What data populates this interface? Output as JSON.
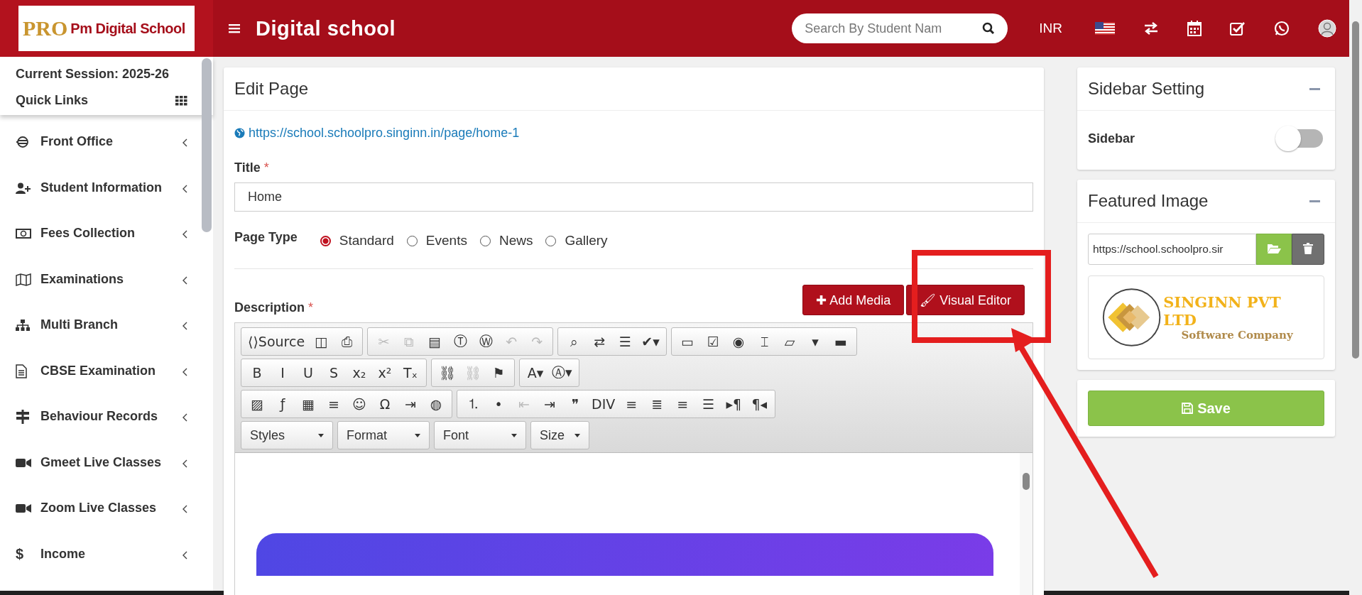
{
  "header": {
    "logo_badge": "PRO",
    "logo_text": "Pm Digital School",
    "title": "Digital school",
    "search": {
      "placeholder": "Search By Student Nam"
    },
    "currency": "INR"
  },
  "sidebar": {
    "session": "Current Session: 2025-26",
    "quick_links": "Quick Links",
    "items": [
      {
        "label": "Front Office"
      },
      {
        "label": "Student Information"
      },
      {
        "label": "Fees Collection"
      },
      {
        "label": "Examinations"
      },
      {
        "label": "Multi Branch"
      },
      {
        "label": "CBSE Examination"
      },
      {
        "label": "Behaviour Records"
      },
      {
        "label": "Gmeet Live Classes"
      },
      {
        "label": "Zoom Live Classes"
      },
      {
        "label": "Income",
        "glyph": "$"
      }
    ]
  },
  "edit_page": {
    "title": "Edit Page",
    "url": "https://school.schoolpro.singinn.in/page/home-1",
    "title_label": "Title",
    "required_mark": "*",
    "title_value": "Home",
    "page_type_label": "Page Type",
    "page_types": [
      {
        "label": "Standard",
        "selected": true
      },
      {
        "label": "Events",
        "selected": false
      },
      {
        "label": "News",
        "selected": false
      },
      {
        "label": "Gallery",
        "selected": false
      }
    ],
    "description_label": "Description",
    "buttons": [
      {
        "label": "Add Media",
        "glyph": "✚"
      },
      {
        "label": "Visual Editor",
        "glyph": "🖌"
      }
    ],
    "toolbar": [
      [
        [
          {
            "label": "Source",
            "glyph": "⟨⟩",
            "disabled": false
          },
          {
            "glyph": "◫",
            "disabled": false
          },
          {
            "glyph": "⎙",
            "disabled": false
          }
        ],
        [
          {
            "glyph": "✂",
            "disabled": true
          },
          {
            "glyph": "⧉",
            "disabled": true
          },
          {
            "glyph": "▤",
            "disabled": false
          },
          {
            "glyph": "Ⓣ",
            "disabled": false
          },
          {
            "glyph": "Ⓦ",
            "disabled": false
          },
          {
            "glyph": "↶",
            "disabled": true
          },
          {
            "glyph": "↷",
            "disabled": true
          }
        ],
        [
          {
            "glyph": "⌕",
            "disabled": false
          },
          {
            "glyph": "⇄",
            "disabled": false
          },
          {
            "glyph": "☰",
            "disabled": false
          },
          {
            "glyph": "✔▾",
            "disabled": false
          }
        ],
        [
          {
            "glyph": "▭",
            "disabled": false
          },
          {
            "glyph": "☑",
            "disabled": false
          },
          {
            "glyph": "◉",
            "disabled": false
          },
          {
            "glyph": "⌶",
            "disabled": false
          },
          {
            "glyph": "▱",
            "disabled": false
          },
          {
            "glyph": "▾",
            "disabled": false
          },
          {
            "glyph": "▬",
            "disabled": false
          }
        ]
      ],
      [
        [
          {
            "glyph": "B",
            "disabled": false
          },
          {
            "glyph": "I",
            "disabled": false
          },
          {
            "glyph": "U",
            "disabled": false
          },
          {
            "glyph": "S",
            "disabled": false
          },
          {
            "glyph": "x₂",
            "disabled": false
          },
          {
            "glyph": "x²",
            "disabled": false
          },
          {
            "glyph": "Tₓ",
            "disabled": false
          }
        ],
        [
          {
            "glyph": "⛓",
            "disabled": false
          },
          {
            "glyph": "⛓",
            "disabled": true
          },
          {
            "glyph": "⚑",
            "disabled": false
          }
        ],
        [
          {
            "glyph": "A▾",
            "disabled": false
          },
          {
            "glyph": "Ⓐ▾",
            "disabled": false
          }
        ]
      ],
      [
        [
          {
            "glyph": "▨",
            "disabled": false
          },
          {
            "glyph": "ƒ",
            "disabled": false
          },
          {
            "glyph": "▦",
            "disabled": false
          },
          {
            "glyph": "≡",
            "disabled": false
          },
          {
            "glyph": "☺",
            "disabled": false
          },
          {
            "glyph": "Ω",
            "disabled": false
          },
          {
            "glyph": "⇥",
            "disabled": false
          },
          {
            "glyph": "◍",
            "disabled": false
          }
        ],
        [
          {
            "glyph": "⒈",
            "disabled": false
          },
          {
            "glyph": "•",
            "disabled": false
          },
          {
            "glyph": "⇤",
            "disabled": true
          },
          {
            "glyph": "⇥",
            "disabled": false
          },
          {
            "glyph": "❞",
            "disabled": false
          },
          {
            "glyph": "DIV",
            "disabled": false
          },
          {
            "glyph": "≡",
            "disabled": false
          },
          {
            "glyph": "≣",
            "disabled": false
          },
          {
            "glyph": "≡",
            "disabled": false
          },
          {
            "glyph": "☰",
            "disabled": false
          },
          {
            "glyph": "▸¶",
            "disabled": false
          },
          {
            "glyph": "¶◂",
            "disabled": false
          }
        ]
      ]
    ],
    "dropdowns": [
      "Styles",
      "Format",
      "Font",
      "Size"
    ]
  },
  "sidebar_setting": {
    "title": "Sidebar Setting",
    "label": "Sidebar",
    "on": false
  },
  "featured_image": {
    "title": "Featured Image",
    "url": "https://school.schoolpro.sir",
    "logo_name": "SINGINN PVT LTD",
    "logo_tagline": "Software Company"
  },
  "save": {
    "label": "Save"
  }
}
